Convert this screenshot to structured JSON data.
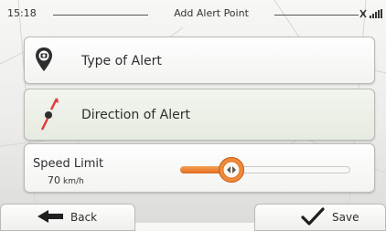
{
  "status": {
    "time": "15:18",
    "title": "Add Alert Point",
    "gps_icon": "gps-signal-icon"
  },
  "items": {
    "type_label": "Type of Alert",
    "type_icon": "speed-camera-icon",
    "direction_label": "Direction of Alert",
    "direction_icon": "direction-arrow-icon"
  },
  "speed": {
    "label": "Speed Limit",
    "value": "70",
    "unit": "km/h",
    "slider_fraction": 0.3
  },
  "buttons": {
    "back_label": "Back",
    "save_label": "Save"
  },
  "colors": {
    "accent": "#e8742a",
    "direction_marker": "#e23b3b"
  }
}
